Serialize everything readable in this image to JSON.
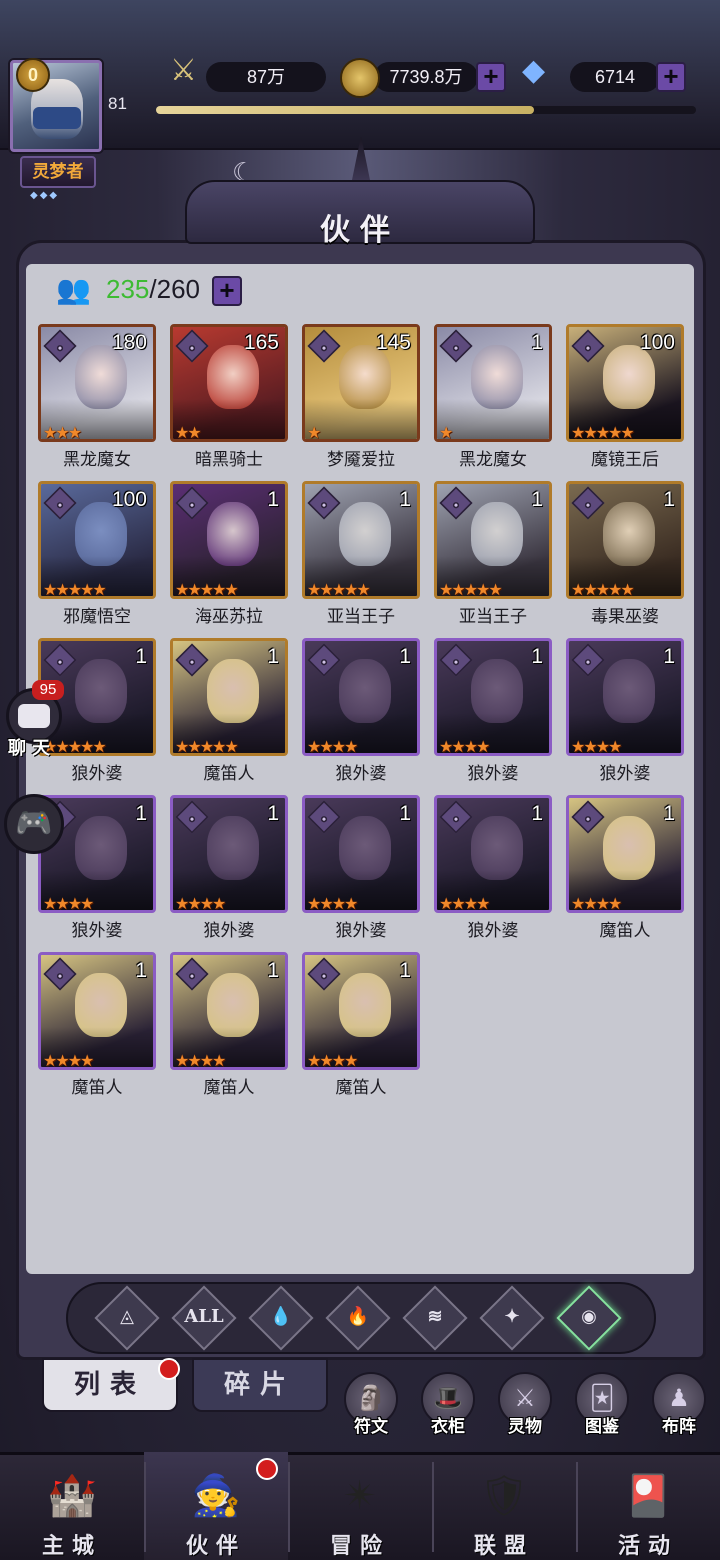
{
  "player": {
    "vip": "0",
    "level": "81",
    "title": "灵梦者",
    "xp_fraction": 0.7
  },
  "resources": {
    "power": "87万",
    "gold": "7739.8万",
    "diamonds": "6714"
  },
  "panel": {
    "title": "伙伴",
    "count_current": "235",
    "count_sep_max": "/260"
  },
  "heroes": [
    {
      "name": "黑龙魔女",
      "level": "180",
      "stars": 3,
      "frame": "red",
      "tone": [
        "#d9d9e2",
        "#8a8aa6",
        "#f0dcd8"
      ]
    },
    {
      "name": "暗黑骑士",
      "level": "165",
      "stars": 2,
      "frame": "red",
      "tone": [
        "#5a1d22",
        "#b83a30",
        "#f1cfc4"
      ]
    },
    {
      "name": "梦魇爱拉",
      "level": "145",
      "stars": 1,
      "frame": "red",
      "tone": [
        "#e8c77b",
        "#b48c3c",
        "#f5dccc"
      ]
    },
    {
      "name": "黑龙魔女",
      "level": "1",
      "stars": 1,
      "frame": "red",
      "tone": [
        "#d9d9e2",
        "#8a8aa6",
        "#f0dcd8"
      ]
    },
    {
      "name": "魔镜王后",
      "level": "100",
      "stars": 5,
      "frame": "gold",
      "tone": [
        "#1b1520",
        "#c8b07a",
        "#efd8cf"
      ]
    },
    {
      "name": "邪魔悟空",
      "level": "100",
      "stars": 5,
      "frame": "gold",
      "tone": [
        "#2a2a44",
        "#5a6a9c",
        "#7b8ec0"
      ]
    },
    {
      "name": "海巫苏拉",
      "level": "1",
      "stars": 5,
      "frame": "gold",
      "tone": [
        "#2b2230",
        "#5b2e74",
        "#d6c6cc"
      ]
    },
    {
      "name": "亚当王子",
      "level": "1",
      "stars": 5,
      "frame": "gold",
      "tone": [
        "#3a3540",
        "#9ea2b0",
        "#d2d0d0"
      ]
    },
    {
      "name": "亚当王子",
      "level": "1",
      "stars": 5,
      "frame": "gold",
      "tone": [
        "#3a3540",
        "#9ea2b0",
        "#d2d0d0"
      ]
    },
    {
      "name": "毒果巫婆",
      "level": "1",
      "stars": 5,
      "frame": "gold",
      "tone": [
        "#3a2c22",
        "#7a6a50",
        "#e0cfb6"
      ]
    },
    {
      "name": "狼外婆",
      "level": "1",
      "stars": 5,
      "frame": "gold",
      "tone": [
        "#1d1a2a",
        "#4a3a5a",
        "#6c5a78"
      ]
    },
    {
      "name": "魔笛人",
      "level": "1",
      "stars": 5,
      "frame": "gold",
      "tone": [
        "#2a2236",
        "#d6c482",
        "#d9bfb0"
      ]
    },
    {
      "name": "狼外婆",
      "level": "1",
      "stars": 4,
      "frame": "purple",
      "tone": [
        "#1d1a2a",
        "#4a3a5a",
        "#6c5a78"
      ]
    },
    {
      "name": "狼外婆",
      "level": "1",
      "stars": 4,
      "frame": "purple",
      "tone": [
        "#1d1a2a",
        "#4a3a5a",
        "#6c5a78"
      ]
    },
    {
      "name": "狼外婆",
      "level": "1",
      "stars": 4,
      "frame": "purple",
      "tone": [
        "#1d1a2a",
        "#4a3a5a",
        "#6c5a78"
      ]
    },
    {
      "name": "狼外婆",
      "level": "1",
      "stars": 4,
      "frame": "purple",
      "tone": [
        "#1d1a2a",
        "#4a3a5a",
        "#6c5a78"
      ]
    },
    {
      "name": "狼外婆",
      "level": "1",
      "stars": 4,
      "frame": "purple",
      "tone": [
        "#1d1a2a",
        "#4a3a5a",
        "#6c5a78"
      ]
    },
    {
      "name": "狼外婆",
      "level": "1",
      "stars": 4,
      "frame": "purple",
      "tone": [
        "#1d1a2a",
        "#4a3a5a",
        "#6c5a78"
      ]
    },
    {
      "name": "狼外婆",
      "level": "1",
      "stars": 4,
      "frame": "purple",
      "tone": [
        "#1d1a2a",
        "#4a3a5a",
        "#6c5a78"
      ]
    },
    {
      "name": "魔笛人",
      "level": "1",
      "stars": 4,
      "frame": "purple",
      "tone": [
        "#2a2236",
        "#d6c482",
        "#d9bfb0"
      ]
    },
    {
      "name": "魔笛人",
      "level": "1",
      "stars": 4,
      "frame": "purple",
      "tone": [
        "#2a2236",
        "#d6c482",
        "#d9bfb0"
      ]
    },
    {
      "name": "魔笛人",
      "level": "1",
      "stars": 4,
      "frame": "purple",
      "tone": [
        "#2a2236",
        "#d6c482",
        "#d9bfb0"
      ]
    },
    {
      "name": "魔笛人",
      "level": "1",
      "stars": 4,
      "frame": "purple",
      "tone": [
        "#2a2236",
        "#d6c482",
        "#d9bfb0"
      ]
    }
  ],
  "filters": [
    {
      "id": "filter-ice-icon",
      "glyph": "◬",
      "active": false
    },
    {
      "id": "filter-all",
      "glyph": "ALL",
      "active": false
    },
    {
      "id": "filter-water-icon",
      "glyph": "💧",
      "active": false
    },
    {
      "id": "filter-fire-icon",
      "glyph": "🔥",
      "active": false
    },
    {
      "id": "filter-wind-icon",
      "glyph": "≋",
      "active": false
    },
    {
      "id": "filter-light-icon",
      "glyph": "✦",
      "active": false
    },
    {
      "id": "filter-dark-icon",
      "glyph": "◉",
      "active": true
    }
  ],
  "tabs": {
    "list": "列表",
    "fragments": "碎片"
  },
  "side_buttons": [
    {
      "id": "rune",
      "label": "符文",
      "glyph": "🗿"
    },
    {
      "id": "wardrobe",
      "label": "衣柜",
      "glyph": "🎩"
    },
    {
      "id": "spirit",
      "label": "灵物",
      "glyph": "⚔"
    },
    {
      "id": "codex",
      "label": "图鉴",
      "glyph": "🃏"
    },
    {
      "id": "formation",
      "label": "布阵",
      "glyph": "♟"
    }
  ],
  "chat": {
    "count": "95",
    "label": "聊天"
  },
  "nav": [
    {
      "id": "main-city",
      "label": "主城",
      "glyph": "🏰",
      "active": false,
      "dot": false
    },
    {
      "id": "partners",
      "label": "伙伴",
      "glyph": "🧙",
      "active": true,
      "dot": true
    },
    {
      "id": "adventure",
      "label": "冒险",
      "glyph": "✴",
      "active": false,
      "dot": false
    },
    {
      "id": "alliance",
      "label": "联盟",
      "glyph": "🛡",
      "active": false,
      "dot": false
    },
    {
      "id": "events",
      "label": "活动",
      "glyph": "🎴",
      "active": false,
      "dot": false
    }
  ],
  "colors": {
    "star": "#f0882a",
    "frame_red": "#7a3a1c",
    "frame_gold": "#b07b2a",
    "frame_purple": "#8b5cc4",
    "count_green": "#3dbb33",
    "badge_red": "#d31d1d"
  }
}
